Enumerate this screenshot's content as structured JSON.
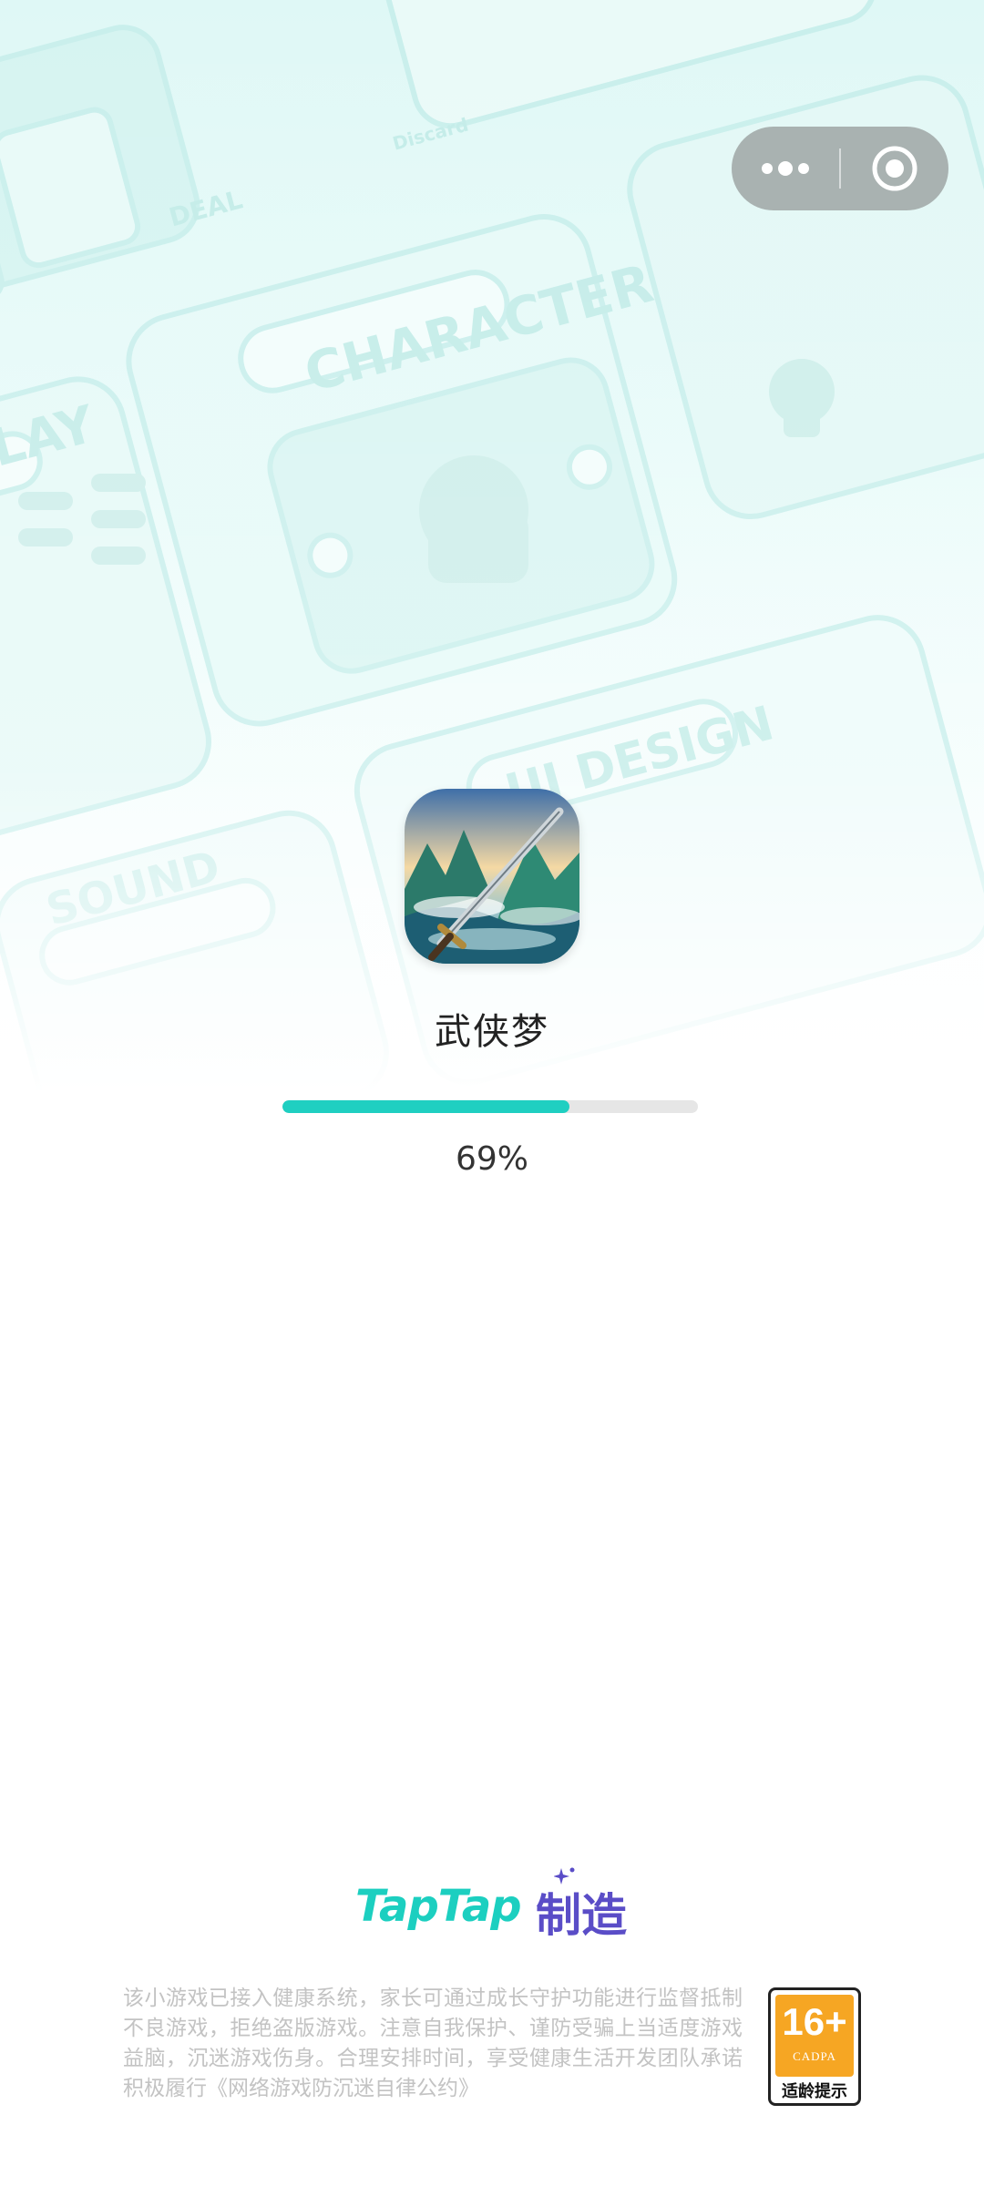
{
  "background": {
    "labels": [
      "CHARACTER",
      "UI DESIGN",
      "SOUND",
      "LAY",
      "DEAL",
      "Discard"
    ]
  },
  "capsule": {
    "more_icon": "more-dots-icon",
    "close_icon": "target-circle-icon"
  },
  "app": {
    "name": "武侠梦",
    "icon": "sword-mountain-app-icon"
  },
  "loading": {
    "progress_percent": 69,
    "progress_text": "69%",
    "accent_color": "#1fcfc1"
  },
  "footer": {
    "brand_latin": "TapTap",
    "brand_cn": "制造",
    "notice": "该小游戏已接入健康系统，家长可通过成长守护功能进行监督抵制不良游戏，拒绝盗版游戏。注意自我保护、谨防受骗上当适度游戏益脑，沉迷游戏伤身。合理安排时间，享受健康生活开发团队承诺积极履行《网络游戏防沉迷自律公约》",
    "age_rating": {
      "value": "16+",
      "org": "CADPA",
      "label": "适龄提示"
    }
  }
}
